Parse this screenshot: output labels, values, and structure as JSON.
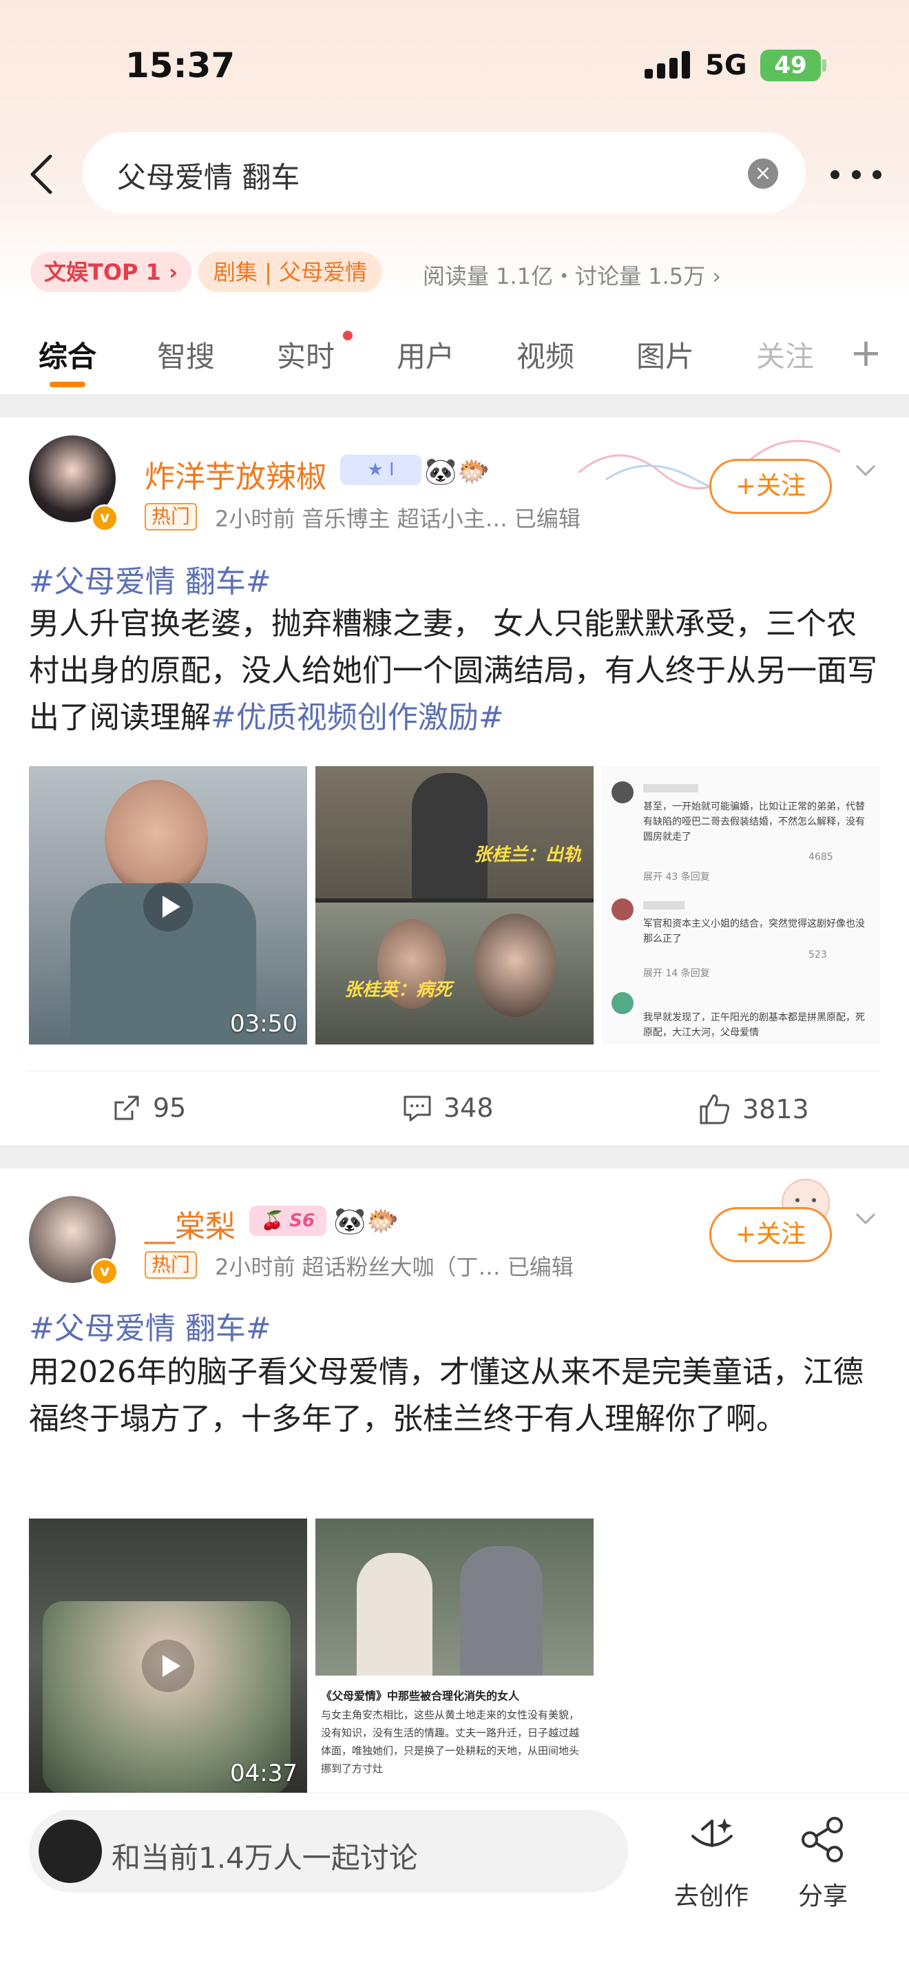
{
  "status_bar": {
    "time": "15:37",
    "network": "5G",
    "battery": "49"
  },
  "search": {
    "query": "父母爱情 翻车"
  },
  "topic": {
    "rank_tag": "文娱TOP 1 ›",
    "category_tag": "剧集 | 父母爱情",
    "stats": "阅读量 1.1亿・讨论量 1.5万 ›"
  },
  "tabs": [
    {
      "label": "综合"
    },
    {
      "label": "智搜"
    },
    {
      "label": "实时"
    },
    {
      "label": "用户"
    },
    {
      "label": "视频"
    },
    {
      "label": "图片"
    },
    {
      "label": "关注"
    }
  ],
  "posts": [
    {
      "username": "炸洋芋放辣椒",
      "hot_tag": "热门",
      "meta": "2小时前 音乐博主 超话小主… 已编辑",
      "follow_label": "+关注",
      "topic": "#父母爱情 翻车#",
      "body": "男人升官换老婆，抛弃糟糠之妻， 女人只能默默承受，三个农村出身的原配，没人给她们一个圆满结局，有人终于从另一面写出了阅读理解",
      "body_tag": "#优质视频创作激励#",
      "video_duration": "03:50",
      "caption_1": "张桂兰：出轨",
      "caption_2": "张桂英：病死",
      "comment_1": "甚至，一开始就可能骗婚，比如让正常的弟弟，代替有缺陷的哑巴二哥去假装结婚，不然怎么解释，没有圆房就走了",
      "comment_1_likes": "4685",
      "comment_1_expand": "展开 43 条回复",
      "comment_2": "军官和资本主义小姐的结合，突然觉得这剧好像也没那么正了",
      "comment_2_likes": "523",
      "comment_2_expand": "展开 14 条回复",
      "comment_3": "我早就发现了，正午阳光的剧基本都是拼黑原配，死原配，大江大河，父母爱情",
      "shares": "95",
      "comments": "348",
      "likes": "3813"
    },
    {
      "username": "__棠梨",
      "hot_tag": "热门",
      "meta": "2小时前 超话粉丝大咖（丁… 已编辑",
      "follow_label": "+关注",
      "topic": "#父母爱情 翻车#",
      "body": "用2026年的脑子看父母爱情，才懂这从来不是完美童话，江德福终于塌方了，十多年了，张桂兰终于有人理解你了啊。",
      "video_duration": "04:37",
      "article_title": "《父母爱情》中那些被合理化消失的女人",
      "article_text": "与女主角安杰相比，这些从黄土地走来的女性没有美貌，没有知识，没有生活的情趣。丈夫一路升迁，日子越过越体面，唯独她们，只是换了一处耕耘的天地，从田间地头挪到了方寸灶"
    }
  ],
  "bottom_bar": {
    "discuss_text": "和当前1.4万人一起讨论",
    "create_label": "去创作",
    "share_label": "分享"
  },
  "colors": {
    "accent": "#ff8200",
    "topic_link": "#5b6fb6",
    "username": "#f07a1e"
  }
}
